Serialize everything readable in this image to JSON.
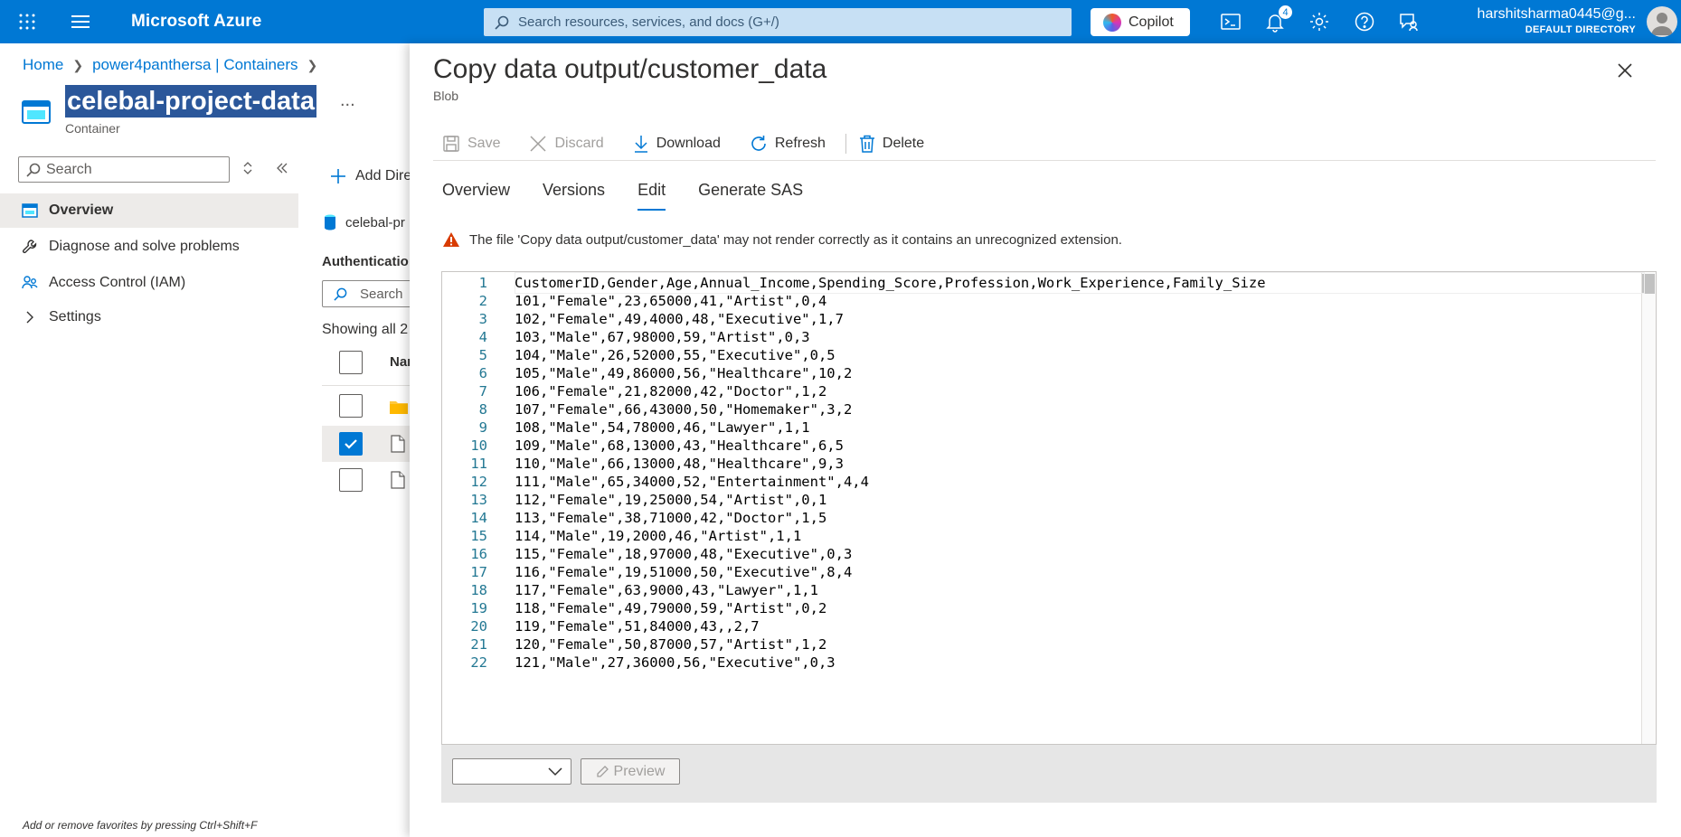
{
  "topbar": {
    "brand": "Microsoft Azure",
    "search_placeholder": "Search resources, services, and docs (G+/)",
    "copilot": "Copilot",
    "notification_count": "4",
    "user_email": "harshitsharma0445@g...",
    "user_directory": "DEFAULT DIRECTORY"
  },
  "breadcrumb": {
    "home": "Home",
    "account": "power4panthersa | Containers"
  },
  "container": {
    "title": "celebal-project-data",
    "subtitle": "Container",
    "more": "..."
  },
  "leftnav": {
    "search_placeholder": "Search",
    "items": [
      "Overview",
      "Diagnose and solve problems",
      "Access Control (IAM)",
      "Settings"
    ]
  },
  "background": {
    "add_directory": "Add Dire",
    "crumb_item": "celebal-pr",
    "auth_label": "Authenticatio",
    "search_placeholder": "Search",
    "showing": "Showing all 2",
    "name_col": "Nar"
  },
  "footer_hint": "Add or remove favorites by pressing Ctrl+Shift+F",
  "panel": {
    "title": "Copy data output/customer_data",
    "subtitle": "Blob",
    "commands": {
      "save": "Save",
      "discard": "Discard",
      "download": "Download",
      "refresh": "Refresh",
      "delete": "Delete"
    },
    "tabs": [
      "Overview",
      "Versions",
      "Edit",
      "Generate SAS"
    ],
    "active_tab": "Edit",
    "warning": "The file 'Copy data output/customer_data' may not render correctly as it contains an unrecognized extension.",
    "preview_button": "Preview"
  },
  "editor_lines": [
    "CustomerID,Gender,Age,Annual_Income,Spending_Score,Profession,Work_Experience,Family_Size",
    "101,\"Female\",23,65000,41,\"Artist\",0,4",
    "102,\"Female\",49,4000,48,\"Executive\",1,7",
    "103,\"Male\",67,98000,59,\"Artist\",0,3",
    "104,\"Male\",26,52000,55,\"Executive\",0,5",
    "105,\"Male\",49,86000,56,\"Healthcare\",10,2",
    "106,\"Female\",21,82000,42,\"Doctor\",1,2",
    "107,\"Female\",66,43000,50,\"Homemaker\",3,2",
    "108,\"Male\",54,78000,46,\"Lawyer\",1,1",
    "109,\"Male\",68,13000,43,\"Healthcare\",6,5",
    "110,\"Male\",66,13000,48,\"Healthcare\",9,3",
    "111,\"Male\",65,34000,52,\"Entertainment\",4,4",
    "112,\"Female\",19,25000,54,\"Artist\",0,1",
    "113,\"Female\",38,71000,42,\"Doctor\",1,5",
    "114,\"Male\",19,2000,46,\"Artist\",1,1",
    "115,\"Female\",18,97000,48,\"Executive\",0,3",
    "116,\"Female\",19,51000,50,\"Executive\",8,4",
    "117,\"Female\",63,9000,43,\"Lawyer\",1,1",
    "118,\"Female\",49,79000,59,\"Artist\",0,2",
    "119,\"Female\",51,84000,43,,2,7",
    "120,\"Female\",50,87000,57,\"Artist\",1,2",
    "121,\"Male\",27,36000,56,\"Executive\",0,3"
  ],
  "colors": {
    "azure_blue": "#0078d4",
    "warning": "#d83b01"
  }
}
